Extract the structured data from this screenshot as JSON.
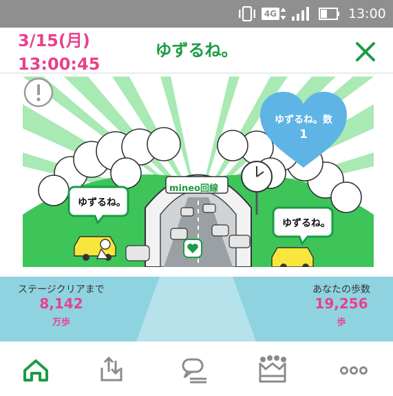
{
  "status_bar": {
    "network": "4G",
    "time": "13:00",
    "icons": [
      "vibrate-icon",
      "network-4g-icon",
      "signal-icon",
      "battery-icon"
    ]
  },
  "header": {
    "date": "3/15(月)",
    "time": "13:00:45",
    "title": "ゆずるね。",
    "close_icon": "close-icon"
  },
  "scene": {
    "alert_icon": "alert-icon",
    "counter_label": "ゆずるね。数",
    "counter_value": "1",
    "brand_sign": "mineo回線",
    "bubble_left": "ゆずるね。",
    "bubble_right": "ゆずるね。"
  },
  "stats": {
    "stage_label": "ステージクリアまで",
    "stage_value": "8,142",
    "stage_unit": "万歩",
    "steps_label": "あなたの歩数",
    "steps_value": "19,256",
    "steps_unit": "歩"
  },
  "nav": [
    {
      "icon": "home-icon",
      "active": true
    },
    {
      "icon": "upload-icon",
      "active": false
    },
    {
      "icon": "chat-icon",
      "active": false
    },
    {
      "icon": "crown-icon",
      "active": false
    },
    {
      "icon": "more-icon",
      "active": false
    }
  ],
  "colors": {
    "accent_green": "#1a9c45",
    "accent_pink": "#e8418e",
    "heart_blue": "#5eb4e5",
    "stats_bg": "#8fd3e0",
    "status_bar": "#8f8f8f"
  }
}
